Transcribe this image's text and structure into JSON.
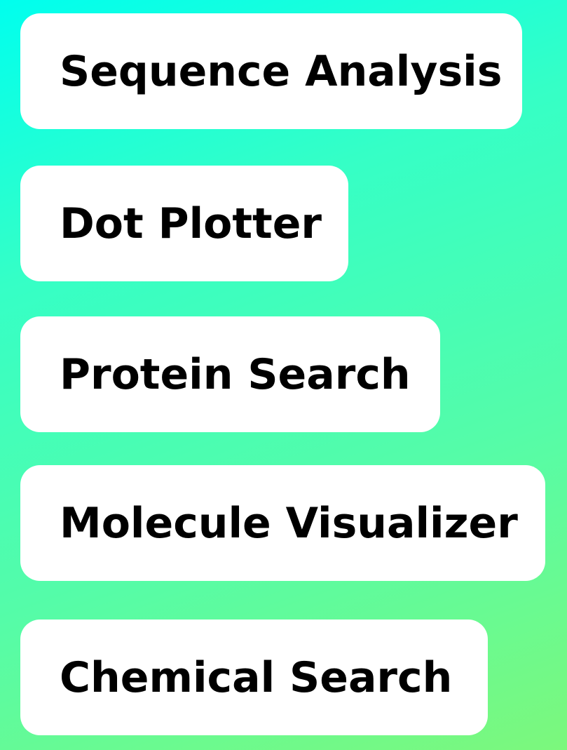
{
  "background": {
    "gradient_start": "#00ffee",
    "gradient_end": "#7cf87c"
  },
  "tools": [
    {
      "label": "Sequence Analysis"
    },
    {
      "label": "Dot Plotter"
    },
    {
      "label": "Protein Search"
    },
    {
      "label": "Molecule Visualizer"
    },
    {
      "label": "Chemical Search"
    }
  ]
}
